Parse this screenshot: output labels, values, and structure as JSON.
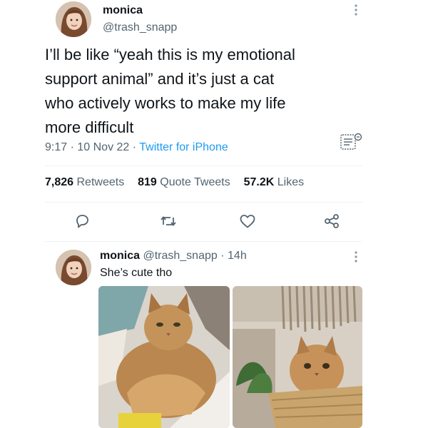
{
  "main_tweet": {
    "display_name": "monica",
    "handle": "@trash_snapp",
    "text_lines": [
      "I’ll be like “yeah this is my emotional",
      "support animal” and it’s just a cat",
      "who actively works to make my life",
      "more difficult"
    ],
    "time": "9:17",
    "date": "10 Nov 22",
    "source": "Twitter for iPhone",
    "sep": "·"
  },
  "stats": {
    "retweets_count": "7,826",
    "retweets_label": "Retweets",
    "quote_count": "819",
    "quote_label": "Quote Tweets",
    "likes_count": "57.2K",
    "likes_label": "Likes"
  },
  "reply": {
    "display_name": "monica",
    "handle": "@trash_snapp",
    "sep": "·",
    "time_ago": "14h",
    "text": "She’s cute tho"
  },
  "icons": {
    "more": "more-dots-icon",
    "analytics": "analytics-icon",
    "reply": "reply-icon",
    "retweet": "retweet-icon",
    "like": "heart-icon",
    "share": "share-icon"
  },
  "colors": {
    "link": "#1d9bf0",
    "muted": "#536471",
    "text": "#0f1419",
    "divider": "#eff3f4"
  }
}
